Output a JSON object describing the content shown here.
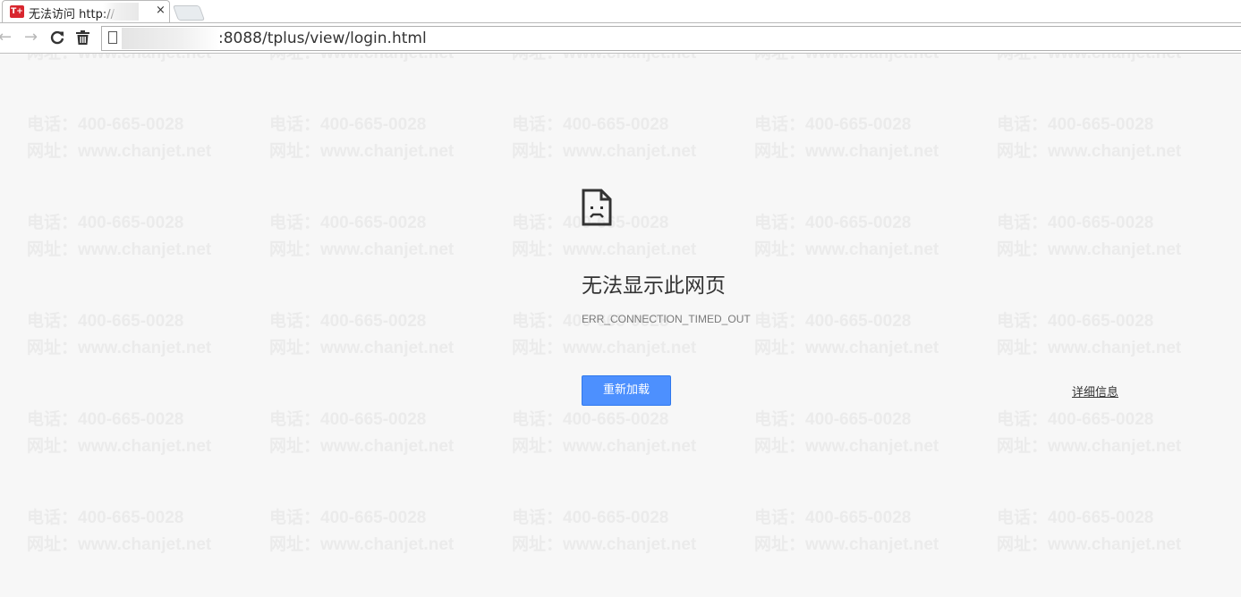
{
  "tab": {
    "favicon_text": "T+",
    "title": "无法访问 http://",
    "close_glyph": "×"
  },
  "toolbar": {
    "back_glyph": "←",
    "forward_glyph": "→",
    "reload_glyph": "↻",
    "trash_glyph": "🗑",
    "url_visible": ":8088/tplus/view/login.html"
  },
  "watermark": {
    "phone": "电话：400-665-0028",
    "site": "网址：www.chanjet.net"
  },
  "error": {
    "icon": "sad-page-icon",
    "title": "无法显示此网页",
    "code": "ERR_CONNECTION_TIMED_OUT",
    "reload_label": "重新加载",
    "details_label": "详细信息"
  },
  "colors": {
    "page_background": "#f7f7f7",
    "button_blue": "#4d90fe",
    "watermark": "#ebebeb"
  }
}
